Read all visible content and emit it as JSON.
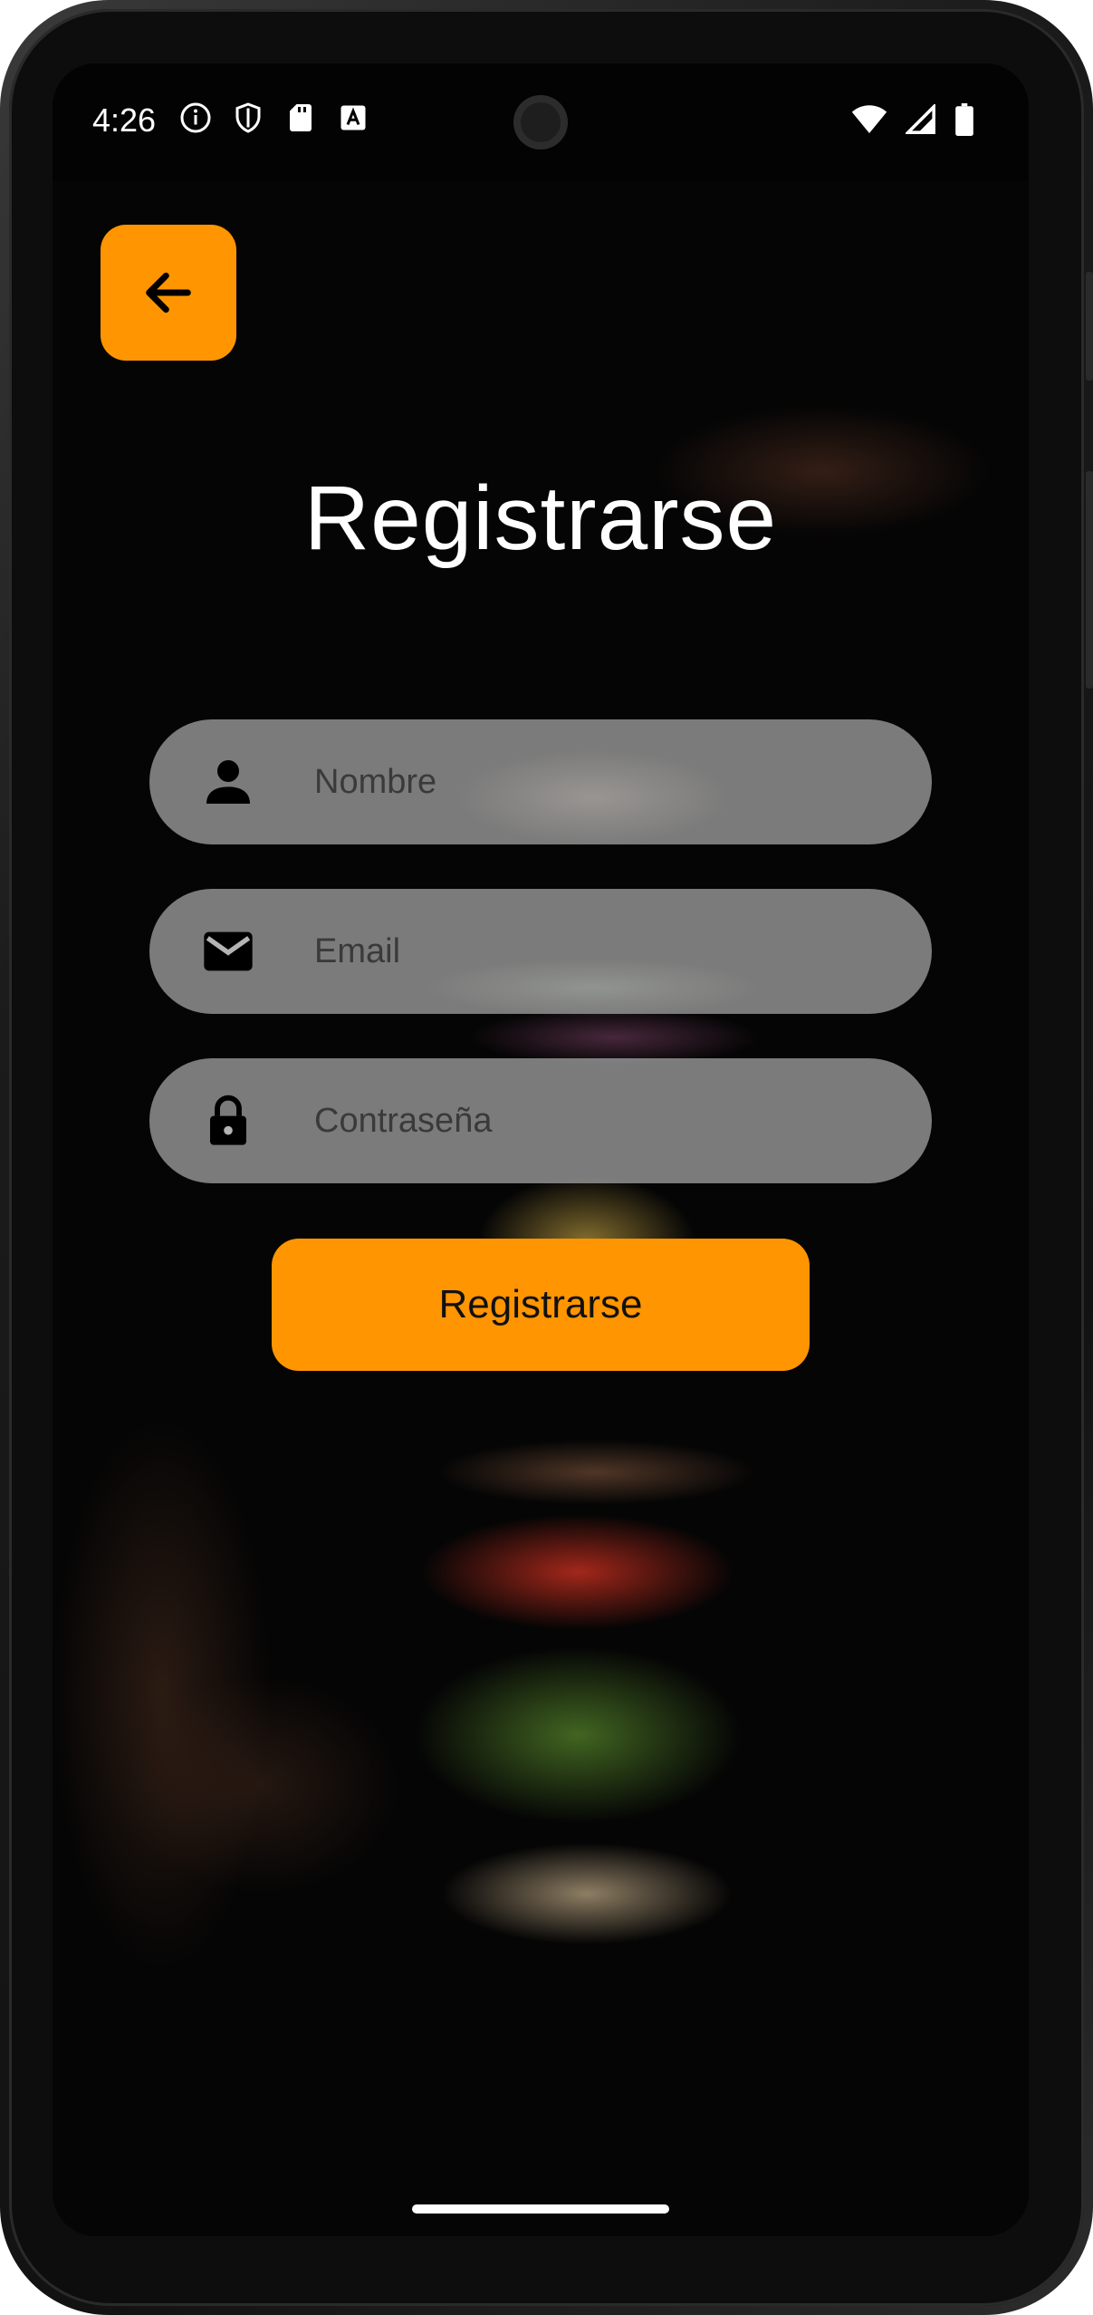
{
  "status_bar": {
    "time": "4:26",
    "left_icons": [
      "info-icon",
      "shield-icon",
      "sd-card-icon",
      "keyboard-icon"
    ],
    "right_icons": [
      "wifi-icon",
      "signal-icon",
      "battery-icon"
    ]
  },
  "header": {
    "back_icon": "arrow-left-icon",
    "title": "Registrarse"
  },
  "form": {
    "fields": [
      {
        "icon": "person-icon",
        "placeholder": "Nombre",
        "value": ""
      },
      {
        "icon": "mail-icon",
        "placeholder": "Email",
        "value": ""
      },
      {
        "icon": "lock-icon",
        "placeholder": "Contraseña",
        "value": ""
      }
    ],
    "submit_label": "Registrarse"
  },
  "colors": {
    "accent": "#ff9500",
    "field_background": "#b4b4b4",
    "title_text": "#ffffff"
  }
}
